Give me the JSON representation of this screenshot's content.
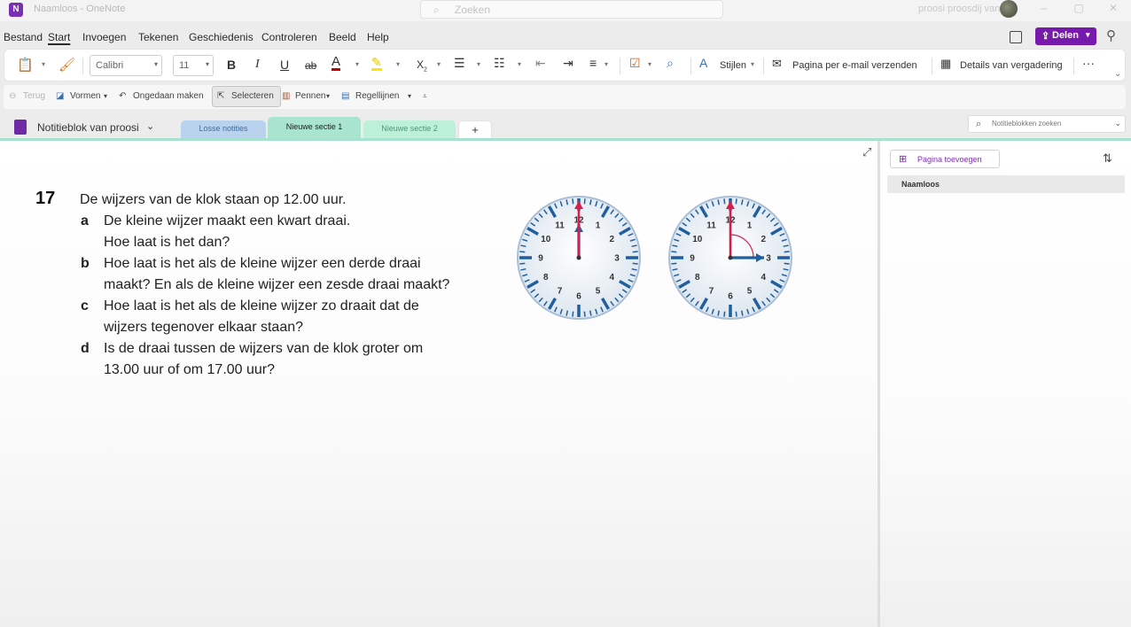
{
  "window": {
    "title": "Naamloos - OneNote",
    "search_placeholder": "Zoeken",
    "user_name": "proosi proosdij van",
    "controls": {
      "minimize": "–",
      "maximize": "▢",
      "close": "✕"
    }
  },
  "menu": {
    "items": [
      "Bestand",
      "Start",
      "Invoegen",
      "Tekenen",
      "Geschiedenis",
      "Controleren",
      "Beeld",
      "Help"
    ],
    "active": "Start",
    "share_label": "Delen"
  },
  "ribbon": {
    "font_name": "Calibri",
    "font_size": "11",
    "bold": "B",
    "italic": "I",
    "underline": "U",
    "strikethrough": "ab",
    "font_color": "A",
    "subscript": "X",
    "styles_label": "Stijlen",
    "email_page_label": "Pagina per e-mail verzenden",
    "meeting_details_label": "Details van vergadering",
    "more": "···"
  },
  "toolbar2": {
    "back": "Terug",
    "shapes": "Vormen",
    "undo": "Ongedaan maken",
    "select": "Selecteren",
    "pens": "Pennen",
    "ruled_lines": "Regellijnen"
  },
  "notebook": {
    "name": "Notitieblok van proosi",
    "sections": [
      {
        "label": "Losse notities",
        "color": "#b9d3ee",
        "text_color": "#3b6ea5"
      },
      {
        "label": "Nieuwe sectie 1",
        "color": "#a8e4cf",
        "text_color": "#1d1d1d"
      },
      {
        "label": "Nieuwe sectie 2",
        "color": "#bdf0d8",
        "text_color": "#4a9a76"
      }
    ],
    "add_section": "+",
    "search_placeholder": "Notitieblokken zoeken"
  },
  "exercise": {
    "number": "17",
    "intro": "De wijzers van de klok staan op 12.00 uur.",
    "parts": [
      {
        "letter": "a",
        "lines": [
          "De kleine wijzer maakt een kwart draai.",
          "Hoe laat is het dan?"
        ]
      },
      {
        "letter": "b",
        "lines": [
          "Hoe laat is het als de kleine wijzer een derde draai",
          "maakt? En als de kleine wijzer een zesde draai maakt?"
        ]
      },
      {
        "letter": "c",
        "lines": [
          "Hoe laat is het als de kleine wijzer zo draait dat de",
          "wijzers tegenover elkaar staan?"
        ]
      },
      {
        "letter": "d",
        "lines": [
          "Is de draai tussen de wijzers van de klok groter om",
          "13.00 uur of om 17.00 uur?"
        ]
      }
    ]
  },
  "clocks": [
    {
      "minute_hand_minutes": 0,
      "hour_hand_hour": 12,
      "show_arc": false
    },
    {
      "minute_hand_minutes": 0,
      "hour_hand_hour": 3,
      "show_arc": true
    }
  ],
  "clock_numbers": [
    "12",
    "1",
    "2",
    "3",
    "4",
    "5",
    "6",
    "7",
    "8",
    "9",
    "10",
    "11"
  ],
  "pages_pane": {
    "add_page": "Pagina toevoegen",
    "pages": [
      "Naamloos"
    ]
  },
  "colors": {
    "accent": "#7719aa",
    "clock_blue": "#1f5fa0",
    "clock_red": "#d61e4e"
  }
}
